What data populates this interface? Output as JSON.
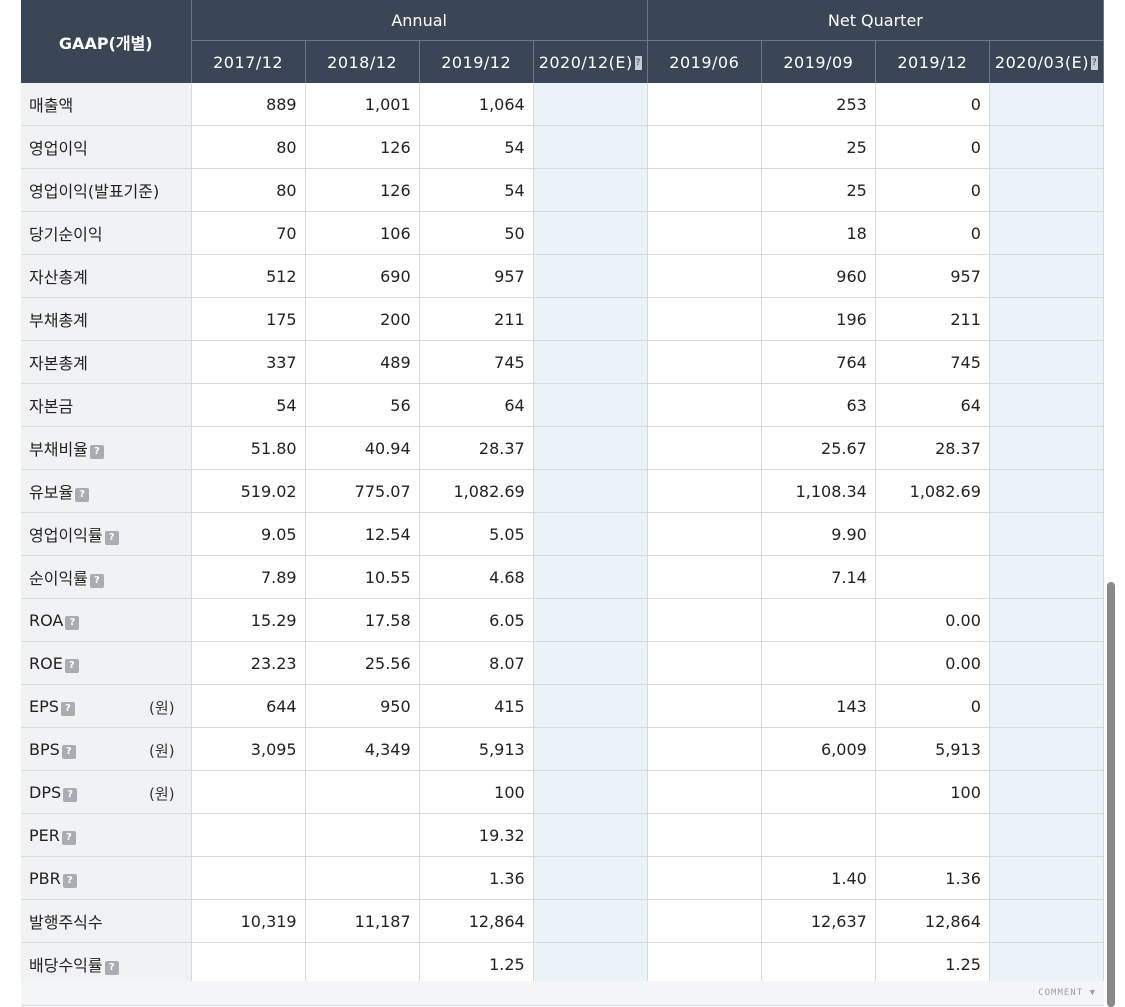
{
  "header": {
    "label": "GAAP(개별)",
    "group_annual": "Annual",
    "group_quarter": "Net Quarter",
    "periods": [
      "2017/12",
      "2018/12",
      "2019/12",
      "2020/12(E)",
      "2019/06",
      "2019/09",
      "2019/12",
      "2020/03(E)"
    ]
  },
  "rows": [
    {
      "label": "매출액",
      "help": false,
      "unit": "",
      "values": [
        "889",
        "1,001",
        "1,064",
        "",
        "",
        "253",
        "0",
        ""
      ]
    },
    {
      "label": "영업이익",
      "help": false,
      "unit": "",
      "values": [
        "80",
        "126",
        "54",
        "",
        "",
        "25",
        "0",
        ""
      ]
    },
    {
      "label": "영업이익(발표기준)",
      "help": false,
      "unit": "",
      "values": [
        "80",
        "126",
        "54",
        "",
        "",
        "25",
        "0",
        ""
      ]
    },
    {
      "label": "당기순이익",
      "help": false,
      "unit": "",
      "values": [
        "70",
        "106",
        "50",
        "",
        "",
        "18",
        "0",
        ""
      ]
    },
    {
      "label": "자산총계",
      "help": false,
      "unit": "",
      "values": [
        "512",
        "690",
        "957",
        "",
        "",
        "960",
        "957",
        ""
      ]
    },
    {
      "label": "부채총계",
      "help": false,
      "unit": "",
      "values": [
        "175",
        "200",
        "211",
        "",
        "",
        "196",
        "211",
        ""
      ]
    },
    {
      "label": "자본총계",
      "help": false,
      "unit": "",
      "values": [
        "337",
        "489",
        "745",
        "",
        "",
        "764",
        "745",
        ""
      ]
    },
    {
      "label": "자본금",
      "help": false,
      "unit": "",
      "values": [
        "54",
        "56",
        "64",
        "",
        "",
        "63",
        "64",
        ""
      ]
    },
    {
      "label": "부채비율",
      "help": true,
      "unit": "",
      "values": [
        "51.80",
        "40.94",
        "28.37",
        "",
        "",
        "25.67",
        "28.37",
        ""
      ]
    },
    {
      "label": "유보율",
      "help": true,
      "unit": "",
      "values": [
        "519.02",
        "775.07",
        "1,082.69",
        "",
        "",
        "1,108.34",
        "1,082.69",
        ""
      ]
    },
    {
      "label": "영업이익률",
      "help": true,
      "unit": "",
      "values": [
        "9.05",
        "12.54",
        "5.05",
        "",
        "",
        "9.90",
        "",
        ""
      ]
    },
    {
      "label": "순이익률",
      "help": true,
      "unit": "",
      "values": [
        "7.89",
        "10.55",
        "4.68",
        "",
        "",
        "7.14",
        "",
        ""
      ]
    },
    {
      "label": "ROA",
      "help": true,
      "unit": "",
      "values": [
        "15.29",
        "17.58",
        "6.05",
        "",
        "",
        "",
        "0.00",
        ""
      ]
    },
    {
      "label": "ROE",
      "help": true,
      "unit": "",
      "values": [
        "23.23",
        "25.56",
        "8.07",
        "",
        "",
        "",
        "0.00",
        ""
      ]
    },
    {
      "label": "EPS",
      "help": true,
      "unit": "(원)",
      "values": [
        "644",
        "950",
        "415",
        "",
        "",
        "143",
        "0",
        ""
      ]
    },
    {
      "label": "BPS",
      "help": true,
      "unit": "(원)",
      "values": [
        "3,095",
        "4,349",
        "5,913",
        "",
        "",
        "6,009",
        "5,913",
        ""
      ]
    },
    {
      "label": "DPS",
      "help": true,
      "unit": "(원)",
      "values": [
        "",
        "",
        "100",
        "",
        "",
        "",
        "100",
        ""
      ]
    },
    {
      "label": "PER",
      "help": true,
      "unit": "",
      "values": [
        "",
        "",
        "19.32",
        "",
        "",
        "",
        "",
        ""
      ]
    },
    {
      "label": "PBR",
      "help": true,
      "unit": "",
      "values": [
        "",
        "",
        "1.36",
        "",
        "",
        "1.40",
        "1.36",
        ""
      ]
    },
    {
      "label": "발행주식수",
      "help": false,
      "unit": "",
      "values": [
        "10,319",
        "11,187",
        "12,864",
        "",
        "",
        "12,637",
        "12,864",
        ""
      ]
    },
    {
      "label": "배당수익률",
      "help": true,
      "unit": "",
      "values": [
        "",
        "",
        "1.25",
        "",
        "",
        "",
        "1.25",
        ""
      ]
    }
  ],
  "help_glyph": "?",
  "estimate_columns": [
    3,
    7
  ],
  "footer": {
    "comment_label": "COMMENT ▼"
  },
  "colors": {
    "header_bg": "#3a4656",
    "label_bg": "#f1f2f4",
    "estimate_bg": "#eaf3f7",
    "border": "#d7d9dc"
  }
}
